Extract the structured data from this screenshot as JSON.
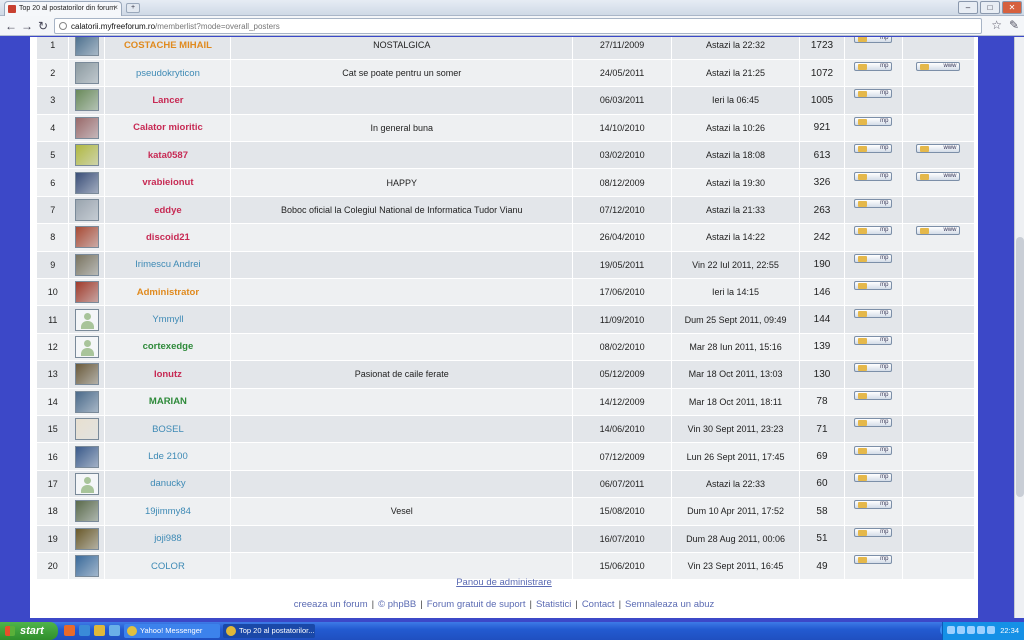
{
  "browser": {
    "tab_title": "Top 20 al postatorilor din forum",
    "tab_close": "×",
    "new_tab": "+",
    "url_host": "calatorii.myfreeforum.ro",
    "url_path": "/memberlist?mode=overall_posters",
    "back": "←",
    "forward": "→",
    "reload": "↻",
    "star": "☆",
    "wrench": "✎",
    "minimize": "–",
    "maximize": "□",
    "close": "✕"
  },
  "members": [
    {
      "rank": "1",
      "username": "COSTACHE MIHAIL",
      "color": "#e08a1e",
      "bold": true,
      "signature": "NOSTALGICA",
      "joined": "27/11/2009",
      "last_visit": "Astazi la 22:32",
      "posts": "1723",
      "avatar": "photo",
      "avatar_color": "#4a6e8c",
      "www": false
    },
    {
      "rank": "2",
      "username": "pseudokryticon",
      "color": "#3e8ab5",
      "bold": false,
      "signature": "Cat se poate pentru un somer",
      "joined": "24/05/2011",
      "last_visit": "Astazi la 21:25",
      "posts": "1072",
      "avatar": "photo",
      "avatar_color": "#8c9aa0",
      "www": true
    },
    {
      "rank": "3",
      "username": "Lancer",
      "color": "#c72a54",
      "bold": true,
      "signature": "",
      "joined": "06/03/2011",
      "last_visit": "Ieri la 06:45",
      "posts": "1005",
      "avatar": "photo",
      "avatar_color": "#6a8a5a",
      "www": false
    },
    {
      "rank": "4",
      "username": "Calator mioritic",
      "color": "#c72a54",
      "bold": true,
      "signature": "In general buna",
      "joined": "14/10/2010",
      "last_visit": "Astazi la 10:26",
      "posts": "921",
      "avatar": "photo",
      "avatar_color": "#9a6a6a",
      "www": false
    },
    {
      "rank": "5",
      "username": "kata0587",
      "color": "#c72a54",
      "bold": true,
      "signature": "",
      "joined": "03/02/2010",
      "last_visit": "Astazi la 18:08",
      "posts": "613",
      "avatar": "photo",
      "avatar_color": "#b0b840",
      "www": true
    },
    {
      "rank": "6",
      "username": "vrabieionut",
      "color": "#c72a54",
      "bold": true,
      "signature": "HAPPY",
      "joined": "08/12/2009",
      "last_visit": "Astazi la 19:30",
      "posts": "326",
      "avatar": "photo",
      "avatar_color": "#3a4e78",
      "www": true
    },
    {
      "rank": "7",
      "username": "eddye",
      "color": "#c72a54",
      "bold": true,
      "signature": "Boboc oficial la Colegiul National de Informatica Tudor Vianu",
      "joined": "07/12/2010",
      "last_visit": "Astazi la 21:33",
      "posts": "263",
      "avatar": "photo",
      "avatar_color": "#9aa4ae",
      "www": false
    },
    {
      "rank": "8",
      "username": "discoid21",
      "color": "#c72a54",
      "bold": true,
      "signature": "",
      "joined": "26/04/2010",
      "last_visit": "Astazi la 14:22",
      "posts": "242",
      "avatar": "photo",
      "avatar_color": "#a84a34",
      "www": true
    },
    {
      "rank": "9",
      "username": "Irimescu Andrei",
      "color": "#3e8ab5",
      "bold": false,
      "signature": "",
      "joined": "19/05/2011",
      "last_visit": "Vin 22 Iul 2011, 22:55",
      "posts": "190",
      "avatar": "photo",
      "avatar_color": "#7a7460",
      "www": false
    },
    {
      "rank": "10",
      "username": "Administrator",
      "color": "#e08a1e",
      "bold": true,
      "signature": "",
      "joined": "17/06/2010",
      "last_visit": "Ieri la 14:15",
      "posts": "146",
      "avatar": "photo",
      "avatar_color": "#a03a2a",
      "www": false
    },
    {
      "rank": "11",
      "username": "Ymmyll",
      "color": "#3e8ab5",
      "bold": false,
      "signature": "",
      "joined": "11/09/2010",
      "last_visit": "Dum 25 Sept 2011, 09:49",
      "posts": "144",
      "avatar": "default",
      "avatar_color": "",
      "www": false
    },
    {
      "rank": "12",
      "username": "cortexedge",
      "color": "#2e8a3a",
      "bold": true,
      "signature": "",
      "joined": "08/02/2010",
      "last_visit": "Mar 28 Iun 2011, 15:16",
      "posts": "139",
      "avatar": "default",
      "avatar_color": "",
      "www": false
    },
    {
      "rank": "13",
      "username": "Ionutz",
      "color": "#c72a54",
      "bold": true,
      "signature": "Pasionat de caile ferate",
      "joined": "05/12/2009",
      "last_visit": "Mar 18 Oct 2011, 13:03",
      "posts": "130",
      "avatar": "photo",
      "avatar_color": "#6a5a3a",
      "www": false
    },
    {
      "rank": "14",
      "username": "MARIAN",
      "color": "#2e8a3a",
      "bold": true,
      "signature": "",
      "joined": "14/12/2009",
      "last_visit": "Mar 18 Oct 2011, 18:11",
      "posts": "78",
      "avatar": "photo",
      "avatar_color": "#4a6a8a",
      "www": false
    },
    {
      "rank": "15",
      "username": "BOSEL",
      "color": "#3e8ab5",
      "bold": false,
      "signature": "",
      "joined": "14/06/2010",
      "last_visit": "Vin 30 Sept 2011, 23:23",
      "posts": "71",
      "avatar": "photo",
      "avatar_color": "#e8e0d0",
      "www": false
    },
    {
      "rank": "16",
      "username": "Lde 2100",
      "color": "#3e8ab5",
      "bold": false,
      "signature": "",
      "joined": "07/12/2009",
      "last_visit": "Lun 26 Sept 2011, 17:45",
      "posts": "69",
      "avatar": "photo",
      "avatar_color": "#3a5a8a",
      "www": false
    },
    {
      "rank": "17",
      "username": "danucky",
      "color": "#3e8ab5",
      "bold": false,
      "signature": "",
      "joined": "06/07/2011",
      "last_visit": "Astazi la 22:33",
      "posts": "60",
      "avatar": "default",
      "avatar_color": "",
      "www": false
    },
    {
      "rank": "18",
      "username": "19jimmy84",
      "color": "#3e8ab5",
      "bold": false,
      "signature": "Vesel",
      "joined": "15/08/2010",
      "last_visit": "Dum 10 Apr 2011, 17:52",
      "posts": "58",
      "avatar": "photo",
      "avatar_color": "#5a6a4a",
      "www": false
    },
    {
      "rank": "19",
      "username": "joji988",
      "color": "#3e8ab5",
      "bold": false,
      "signature": "",
      "joined": "16/07/2010",
      "last_visit": "Dum 28 Aug 2011, 00:06",
      "posts": "51",
      "avatar": "photo",
      "avatar_color": "#6a5a2a",
      "www": false
    },
    {
      "rank": "20",
      "username": "COLOR",
      "color": "#3e8ab5",
      "bold": false,
      "signature": "",
      "joined": "15/06/2010",
      "last_visit": "Vin 23 Sept 2011, 16:45",
      "posts": "49",
      "avatar": "photo",
      "avatar_color": "#3a6a9a",
      "www": false
    }
  ],
  "buttons": {
    "pm": "mp",
    "www": "www"
  },
  "admin_link": "Panou de administrare",
  "footer": {
    "links": [
      {
        "label": "creeaza un forum",
        "name": "create-forum-link"
      },
      {
        "label": "© phpBB",
        "name": "phpbb-link"
      },
      {
        "label": "Forum gratuit de suport",
        "name": "support-forum-link"
      },
      {
        "label": "Statistici",
        "name": "statistics-link"
      },
      {
        "label": "Contact",
        "name": "contact-link"
      },
      {
        "label": "Semnaleaza un abuz",
        "name": "report-abuse-link"
      }
    ],
    "separator": "|"
  },
  "taskbar": {
    "start_label": "start",
    "buttons": [
      {
        "label": "Yahoo! Messenger",
        "name": "taskbar-yahoo-messenger"
      },
      {
        "label": "Top 20 al postatorilor...",
        "name": "taskbar-chrome-window"
      }
    ],
    "clock": "22:34"
  }
}
